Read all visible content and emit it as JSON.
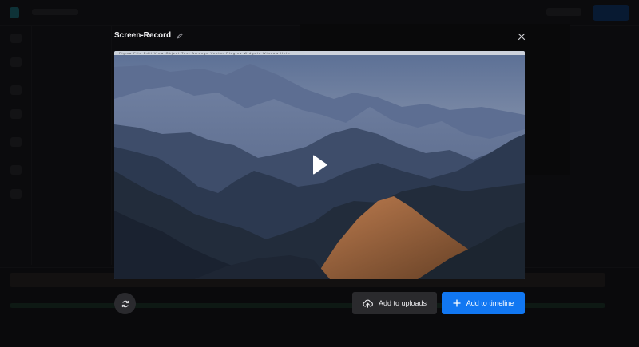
{
  "modal": {
    "title": "Screen-Record",
    "buttons": {
      "add_to_uploads": "Add to uploads",
      "add_to_timeline": "Add to timeline"
    },
    "icons": {
      "edit": "pencil-icon",
      "close": "close-icon",
      "play": "play-icon",
      "replace": "refresh-icon",
      "upload": "cloud-upload-icon",
      "add": "plus-icon"
    }
  },
  "preview": {
    "menubar_text": "Figma  File  Edit  View  Object  Text  Arrange  Vector  Plugins  Widgets  Window  Help"
  },
  "colors": {
    "accent": "#1177f2",
    "secondary_button": "#2a2a2d",
    "modal_overlay": "#050506"
  }
}
